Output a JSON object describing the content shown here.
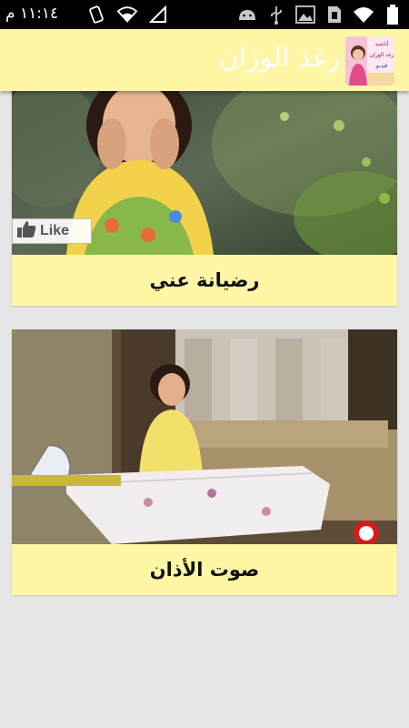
{
  "status_bar": {
    "time": "١١:١٤ م",
    "icons": [
      "battery-icon",
      "signal-icon",
      "wifi-icon",
      "screenshot-icon",
      "image-icon",
      "usb-icon",
      "android-icon"
    ]
  },
  "action_bar": {
    "title": "رغد الوزان",
    "logo_text": [
      "أناشيد",
      "رغد الوزان",
      "فيديو"
    ]
  },
  "videos": [
    {
      "title": "رضيانة عني",
      "badge": "Like"
    },
    {
      "title": "صوت الأذان"
    }
  ],
  "colors": {
    "accent": "#fff7a6",
    "background": "#e6e6e6",
    "status_bar": "#000000"
  }
}
